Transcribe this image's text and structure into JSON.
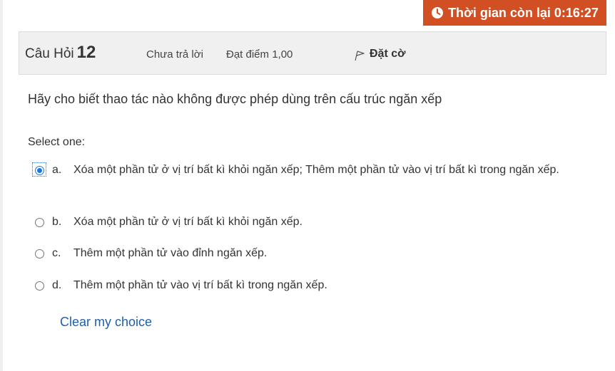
{
  "timer": {
    "label": "Thời gian còn lại 0:16:27",
    "icon": "clock-icon",
    "color": "#d14f22"
  },
  "info": {
    "question_label": "Câu Hỏi",
    "question_number": "12",
    "status": "Chưa trả lời",
    "points": "Đạt điểm 1,00",
    "flag_label": "Đặt cờ",
    "flag_icon": "flag-icon"
  },
  "question": {
    "text": "Hãy cho biết thao tác nào không được phép dùng trên cấu trúc ngăn xếp",
    "select_label": "Select one:",
    "options": [
      {
        "letter": "a.",
        "text": "Xóa một phần tử ở vị trí bất kì khỏi ngăn xếp; Thêm một phần tử vào vị trí bất kì trong ngăn xếp.",
        "selected": true
      },
      {
        "letter": "b.",
        "text": "Xóa một phần tử ở vị trí bất kì khỏi ngăn xếp.",
        "selected": false
      },
      {
        "letter": "c.",
        "text": "Thêm một phần tử vào đỉnh ngăn xếp.",
        "selected": false
      },
      {
        "letter": "d.",
        "text": "Thêm một phần tử vào vị trí bất kì trong ngăn xếp.",
        "selected": false
      }
    ],
    "clear_label": "Clear my choice"
  },
  "colors": {
    "link": "#1f5fa8",
    "radio_selected": "#1a73e8"
  }
}
